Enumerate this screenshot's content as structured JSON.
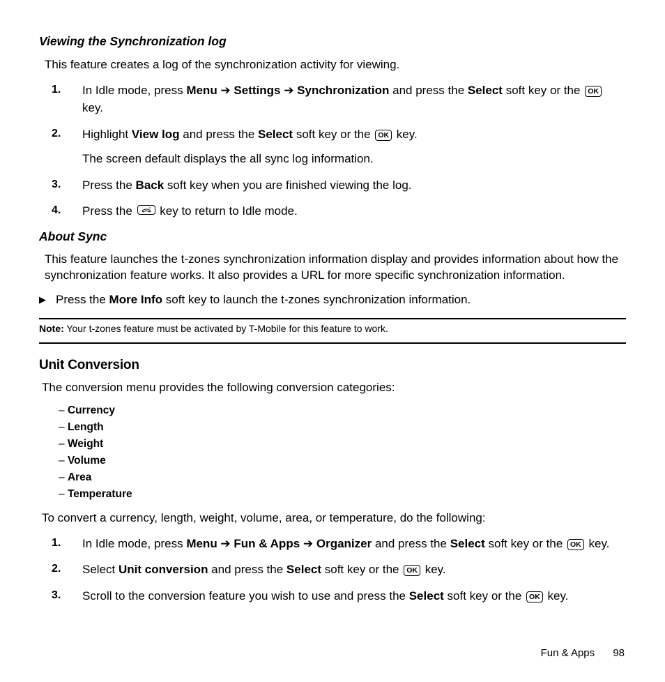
{
  "sec1": {
    "title": "Viewing the Synchronization log",
    "intro": "This feature creates a log of the synchronization activity for viewing.",
    "step1_a": "In Idle mode, press ",
    "step1_menu": "Menu",
    "step1_arrow": " ➔ ",
    "step1_settings": "Settings",
    "step1_arrow2": " ➔ ",
    "step1_sync": "Synchronization",
    "step1_b": " and press the ",
    "step1_select": "Select",
    "step1_c": " soft key or the ",
    "step1_d": " key.",
    "step2_a": "Highlight ",
    "step2_viewlog": "View log",
    "step2_b": " and press the ",
    "step2_select": "Select",
    "step2_c": " soft key or the ",
    "step2_d": " key.",
    "step2_sub": "The screen default displays the all sync log information.",
    "step3_a": "Press the ",
    "step3_back": "Back",
    "step3_b": " soft key when you are finished viewing the log.",
    "step4_a": "Press the ",
    "step4_b": " key to return to Idle mode."
  },
  "sec2": {
    "title": "About Sync",
    "intro": "This feature launches the t-zones synchronization information display and provides information about how the synchronization feature works. It also provides a URL for more specific synchronization information.",
    "bullet_a": "Press the ",
    "bullet_more": "More Info",
    "bullet_b": " soft key to launch the t-zones synchronization information.",
    "note_label": "Note:",
    "note_body": " Your t-zones feature must be activated by T-Mobile for this feature to work."
  },
  "sec3": {
    "title": "Unit Conversion",
    "intro": "The conversion menu provides the following conversion categories:",
    "cats": [
      "Currency",
      "Length",
      "Weight",
      "Volume",
      "Area",
      "Temperature"
    ],
    "intro2": "To convert a currency, length, weight, volume, area, or temperature, do the following:",
    "step1_a": "In Idle mode, press ",
    "step1_menu": "Menu",
    "step1_arr1": " ➔ ",
    "step1_fun": "Fun & Apps",
    "step1_arr2": " ➔ ",
    "step1_org": "Organizer",
    "step1_b": " and press the ",
    "step1_select": "Select",
    "step1_c": " soft key or the ",
    "step1_d": " key.",
    "step2_a": "Select ",
    "step2_uc": "Unit conversion",
    "step2_b": " and press the ",
    "step2_select": "Select",
    "step2_c": " soft key or the ",
    "step2_d": " key.",
    "step3_a": "Scroll to the conversion feature you wish to use and press the ",
    "step3_select": "Select",
    "step3_b": " soft key or the ",
    "step3_c": " key."
  },
  "footer": {
    "section": "Fun & Apps",
    "page": "98"
  },
  "ok_label": "OK"
}
